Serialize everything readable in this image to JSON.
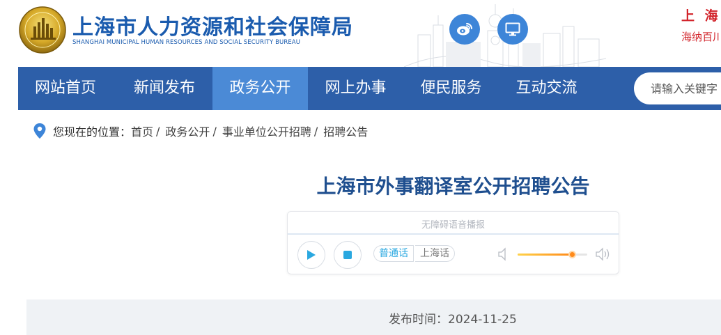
{
  "header": {
    "title": "上海市人力资源和社会保障局",
    "subtitle": "SHANGHAI MUNICIPAL HUMAN RESOURCES AND SOCIAL SECURITY BUREAU",
    "slogan_line1": "上 海 城",
    "slogan_line2": "海纳百川"
  },
  "social": {
    "weibo_icon": "weibo-icon",
    "screen_icon": "monitor-icon"
  },
  "nav": {
    "items": [
      {
        "label": "网站首页"
      },
      {
        "label": "新闻发布"
      },
      {
        "label": "政务公开"
      },
      {
        "label": "网上办事"
      },
      {
        "label": "便民服务"
      },
      {
        "label": "互动交流"
      }
    ],
    "active_index": 2,
    "search_placeholder": "请输入关键字"
  },
  "breadcrumb": {
    "prefix": "您现在的位置：",
    "items": [
      "首页",
      "政务公开",
      "事业单位公开招聘",
      "招聘公告"
    ],
    "separator": "/"
  },
  "article": {
    "title": "上海市外事翻译室公开招聘公告"
  },
  "player": {
    "label": "无障碍语音播报",
    "lang_mandarin": "普通话",
    "lang_shanghainese": "上海话",
    "active_lang": "普通话",
    "volume": 0.78
  },
  "publish": {
    "text": "发布时间：2024-11-25"
  },
  "colors": {
    "brand_blue": "#2d5fa9",
    "nav_active": "#4b8ad6",
    "title_blue": "#1f4f8f",
    "slogan_red": "#d2232a",
    "accent_cyan": "#2aa8e0",
    "volume_orange": "#ff8a1a"
  }
}
